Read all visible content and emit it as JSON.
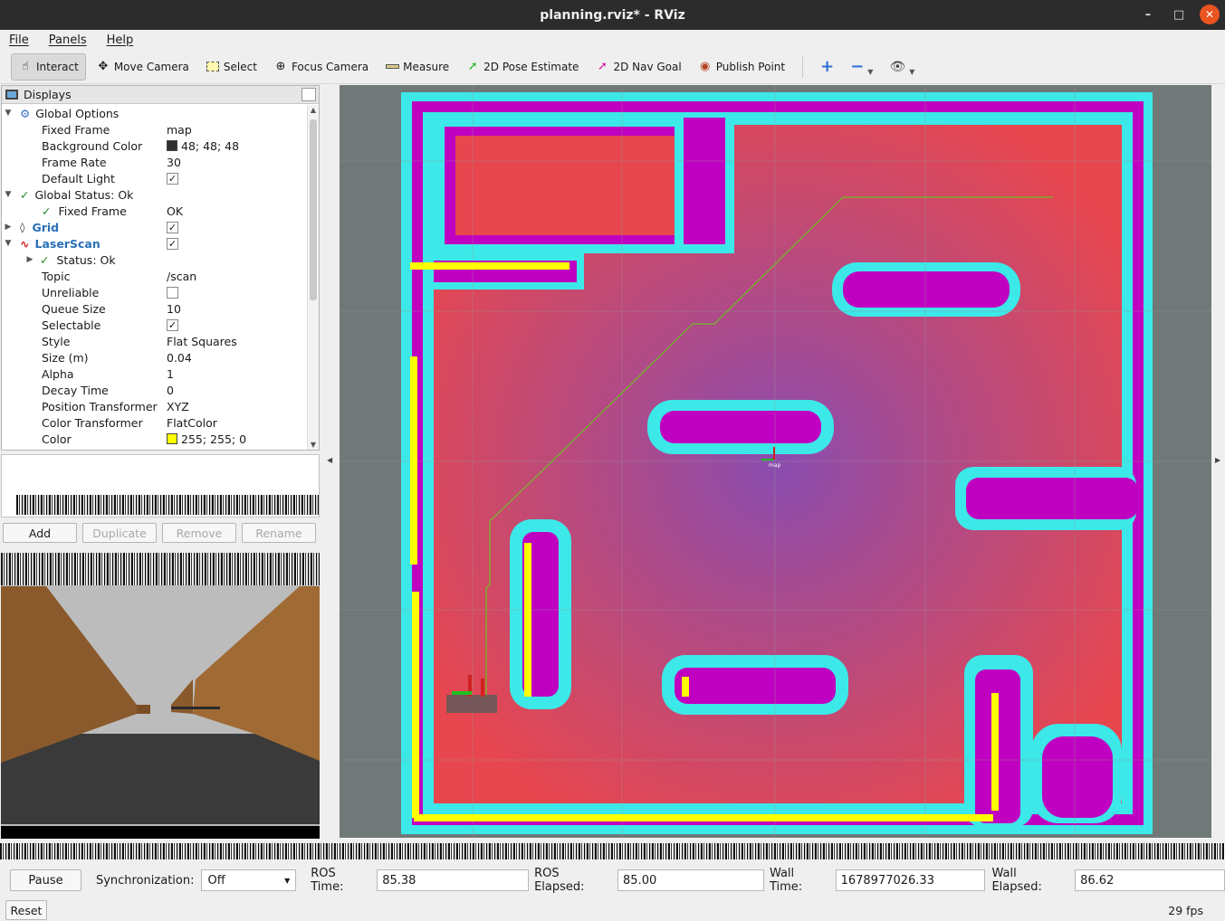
{
  "window": {
    "title": "planning.rviz* - RViz"
  },
  "menu": [
    "File",
    "Panels",
    "Help"
  ],
  "toolbar": {
    "tools": [
      {
        "label": "Interact",
        "icon": "hand-icon",
        "active": true
      },
      {
        "label": "Move Camera",
        "icon": "move-camera-icon"
      },
      {
        "label": "Select",
        "icon": "select-icon"
      },
      {
        "label": "Focus Camera",
        "icon": "focus-camera-icon"
      },
      {
        "label": "Measure",
        "icon": "ruler-icon"
      },
      {
        "label": "2D Pose Estimate",
        "icon": "pose-arrow-icon"
      },
      {
        "label": "2D Nav Goal",
        "icon": "goal-arrow-icon"
      },
      {
        "label": "Publish Point",
        "icon": "pin-icon"
      }
    ]
  },
  "displays": {
    "title": "Displays",
    "rows": [
      {
        "key": "Global Options",
        "value": ""
      },
      {
        "key": "Fixed Frame",
        "value": "map"
      },
      {
        "key": "Background Color",
        "value": "48; 48; 48"
      },
      {
        "key": "Frame Rate",
        "value": "30"
      },
      {
        "key": "Default Light",
        "value": ""
      },
      {
        "key": "Global Status: Ok",
        "value": ""
      },
      {
        "key": "Fixed Frame",
        "value": "OK"
      },
      {
        "key": "Grid",
        "value": ""
      },
      {
        "key": "LaserScan",
        "value": ""
      },
      {
        "key": "Status: Ok",
        "value": ""
      },
      {
        "key": "Topic",
        "value": "/scan"
      },
      {
        "key": "Unreliable",
        "value": ""
      },
      {
        "key": "Queue Size",
        "value": "10"
      },
      {
        "key": "Selectable",
        "value": ""
      },
      {
        "key": "Style",
        "value": "Flat Squares"
      },
      {
        "key": "Size (m)",
        "value": "0.04"
      },
      {
        "key": "Alpha",
        "value": "1"
      },
      {
        "key": "Decay Time",
        "value": "0"
      },
      {
        "key": "Position Transformer",
        "value": "XYZ"
      },
      {
        "key": "Color Transformer",
        "value": "FlatColor"
      },
      {
        "key": "Color",
        "value": "255; 255; 0"
      }
    ],
    "buttons": [
      "Add",
      "Duplicate",
      "Remove",
      "Rename"
    ]
  },
  "colors": {
    "background_swatch": "#303030",
    "laser_swatch": "#ffff00",
    "costmap_cyan": "#3ce8e8",
    "costmap_magenta": "#c000c0",
    "path_green": "#6cc020"
  },
  "timebar": {
    "pause": "Pause",
    "sync_label": "Synchronization:",
    "sync_value": "Off",
    "ros_time_label": "ROS Time:",
    "ros_time": "85.38",
    "ros_elapsed_label": "ROS Elapsed:",
    "ros_elapsed": "85.00",
    "wall_time_label": "Wall Time:",
    "wall_time": "1678977026.33",
    "wall_elapsed_label": "Wall Elapsed:",
    "wall_elapsed": "86.62"
  },
  "status": {
    "reset": "Reset",
    "fps": "29 fps"
  },
  "map_labels": {
    "map_frame": "map"
  }
}
